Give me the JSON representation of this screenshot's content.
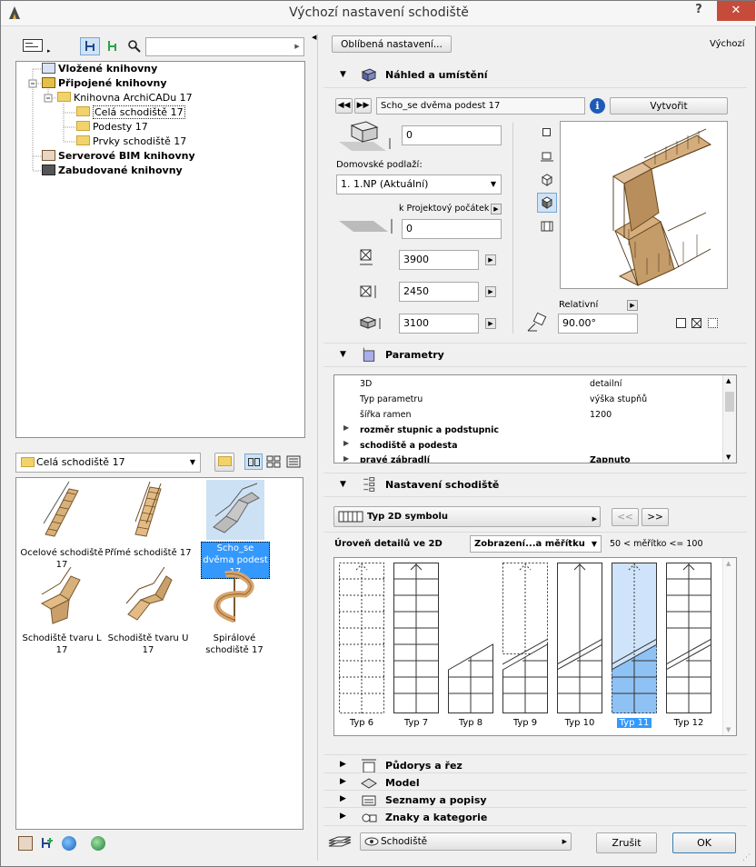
{
  "window": {
    "title": "Výchozí nastavení schodiště",
    "help_label": "?",
    "close_label": "✕"
  },
  "library": {
    "tree": [
      {
        "label": "Vložené knihovny",
        "bold": true
      },
      {
        "label": "Připojené knihovny",
        "bold": true
      },
      {
        "label": "Knihovna ArchiCADu 17",
        "bold": false
      },
      {
        "label": "Celá schodiště 17",
        "bold": false,
        "selected": true
      },
      {
        "label": "Podesty 17",
        "bold": false
      },
      {
        "label": "Prvky schodiště 17",
        "bold": false
      },
      {
        "label": "Serverové BIM knihovny",
        "bold": true
      },
      {
        "label": "Zabudované knihovny",
        "bold": true
      }
    ],
    "folder_select": "Celá schodiště 17",
    "items": [
      {
        "label": "Ocelové schodiště 17",
        "selected": false
      },
      {
        "label": "Přímé schodiště 17",
        "selected": false
      },
      {
        "label": "Scho_se dvěma podest 17",
        "selected": true
      },
      {
        "label": "Schodiště tvaru L 17",
        "selected": false
      },
      {
        "label": "Schodiště tvaru U 17",
        "selected": false
      },
      {
        "label": "Spirálové schodiště 17",
        "selected": false
      }
    ]
  },
  "toolbar": {
    "favorites_label": "Oblíbená nastavení...",
    "default_label": "Výchozí"
  },
  "preview": {
    "section_title": "Náhled a umístění",
    "object_name": "Scho_se dvěma podest 17",
    "create_label": "Vytvořit",
    "offset_value": "0",
    "home_floor_label": "Domovské podlaží:",
    "home_floor_value": "1. 1.NP (Aktuální)",
    "project_origin_label": "k Projektový počátek",
    "elevation_value": "0",
    "width_value": "3900",
    "depth_value": "2450",
    "height_value": "3100",
    "relative_label": "Relativní",
    "angle_value": "90.00°"
  },
  "parameters": {
    "section_title": "Parametry",
    "rows": [
      {
        "name": "3D",
        "value": "detailní",
        "bold": false,
        "expand": false
      },
      {
        "name": "Typ parametru",
        "value": "výška stupňů",
        "bold": false,
        "expand": false
      },
      {
        "name": "šířka ramen",
        "value": "1200",
        "bold": false,
        "expand": false
      },
      {
        "name": "rozměr stupnic a podstupnic",
        "value": "",
        "bold": true,
        "expand": true
      },
      {
        "name": "schodiště a podesta",
        "value": "",
        "bold": true,
        "expand": true
      },
      {
        "name": "pravé zábradlí",
        "value": "Zapnuto",
        "bold": true,
        "expand": true
      }
    ]
  },
  "stair_settings": {
    "section_title": "Nastavení schodiště",
    "symbol_type_label": "Typ 2D symbolu",
    "prev_label": "<<",
    "next_label": ">>",
    "detail_level_label": "Úroveň detailů ve 2D",
    "display_select": "Zobrazení...a měřítku",
    "scale_text": "50 < měřítko <= 100",
    "types": [
      "Typ 6",
      "Typ 7",
      "Typ 8",
      "Typ 9",
      "Typ 10",
      "Typ 11",
      "Typ 12"
    ],
    "selected_type": "Typ 11"
  },
  "collapsed_sections": [
    {
      "label": "Půdorys a řez"
    },
    {
      "label": "Model"
    },
    {
      "label": "Seznamy a popisy"
    },
    {
      "label": "Znaky a kategorie"
    }
  ],
  "footer": {
    "layer_select": "Schodiště",
    "cancel_label": "Zrušit",
    "ok_label": "OK"
  }
}
